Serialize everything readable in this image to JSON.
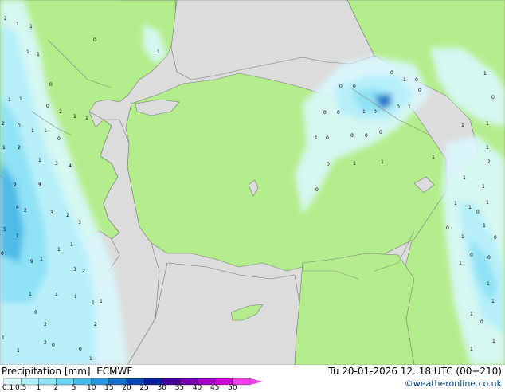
{
  "header": {
    "title": "Precipitation [mm]",
    "model": "ECMWF",
    "valid_time": "Tu 20-01-2026 12..18 UTC (00+210)"
  },
  "credit": "©weatheronline.co.uk",
  "legend": {
    "labels": [
      "0.1",
      "0.5",
      "1",
      "2",
      "5",
      "10",
      "15",
      "20",
      "25",
      "30",
      "35",
      "40",
      "45",
      "50"
    ],
    "colors": [
      "#d8f6fc",
      "#b2eef8",
      "#8ee2f4",
      "#6cd0ee",
      "#4cb8e6",
      "#2e96d8",
      "#1a6ec6",
      "#0c46b2",
      "#08209a",
      "#40009a",
      "#7000b0",
      "#a000c8",
      "#d000d8",
      "#f040e8"
    ]
  },
  "map": {
    "land_color": "#b4ee8c",
    "sea_color": "#dcdcdc",
    "values": [
      "2",
      "1",
      "1",
      "0",
      "1",
      "1",
      "2",
      "1",
      "1",
      "0",
      "1",
      "1",
      "1",
      "0",
      "2",
      "0",
      "1",
      "1",
      "0",
      "1",
      "2",
      "1",
      "3",
      "4",
      "3",
      "2",
      "4",
      "2",
      "5",
      "3",
      "2",
      "3",
      "5",
      "1",
      "9",
      "0",
      "1",
      "1",
      "1",
      "3",
      "2",
      "1",
      "4",
      "1",
      "0",
      "2",
      "1",
      "1",
      "2",
      "1",
      "1",
      "2",
      "0",
      "0",
      "1",
      "0",
      "0",
      "1",
      "0",
      "0",
      "0",
      "0",
      "1",
      "0",
      "0",
      "0",
      "1",
      "1",
      "0",
      "0",
      "0",
      "0",
      "0",
      "1",
      "1",
      "1",
      "0",
      "1",
      "1",
      "1",
      "0",
      "1",
      "1",
      "0",
      "0",
      "1",
      "0",
      "1",
      "1",
      "1",
      "0",
      "1",
      "1",
      "1",
      "2",
      "1",
      "1",
      "0",
      "1",
      "0",
      "1",
      "1"
    ]
  }
}
